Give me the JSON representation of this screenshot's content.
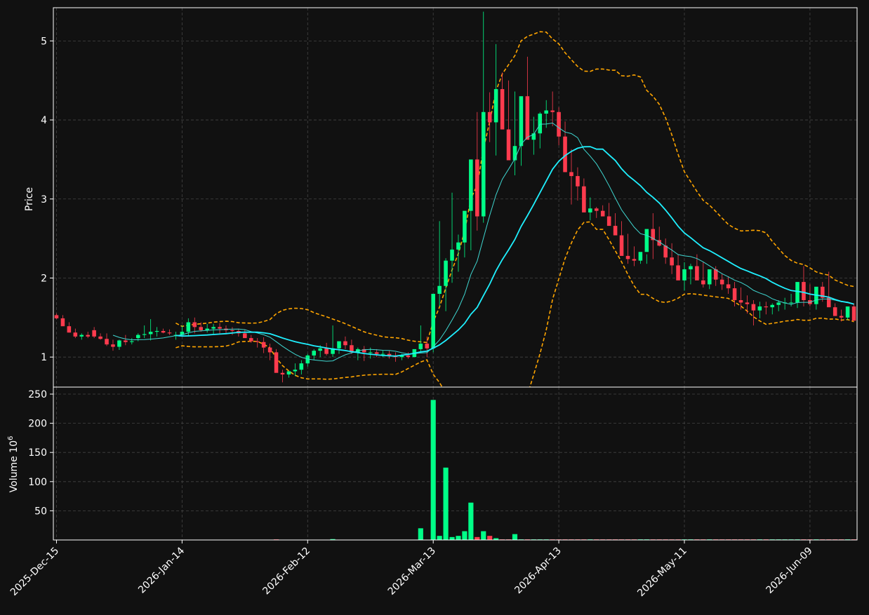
{
  "colors": {
    "background": "#111111",
    "up": "#00ff88",
    "down": "#ff3b4e",
    "grid": "#444444",
    "frame": "#ffffff",
    "ma_fast": "#3fd6d0",
    "ma_slow": "#1ff0ff",
    "band": "#ffa500"
  },
  "chart_data": {
    "type": "candlestick",
    "grid": true,
    "dates": [
      "2025-Dec-15",
      "2025-Dec-16",
      "2025-Dec-17",
      "2025-Dec-18",
      "2025-Dec-19",
      "2025-Dec-22",
      "2025-Dec-23",
      "2025-Dec-24",
      "2025-Dec-26",
      "2025-Dec-29",
      "2025-Dec-30",
      "2025-Dec-31",
      "2026-Jan-02",
      "2026-Jan-05",
      "2026-Jan-06",
      "2026-Jan-07",
      "2026-Jan-08",
      "2026-Jan-09",
      "2026-Jan-12",
      "2026-Jan-13",
      "2026-Jan-14",
      "2026-Jan-15",
      "2026-Jan-16",
      "2026-Jan-20",
      "2026-Jan-21",
      "2026-Jan-22",
      "2026-Jan-23",
      "2026-Jan-26",
      "2026-Jan-27",
      "2026-Jan-28",
      "2026-Jan-29",
      "2026-Jan-30",
      "2026-Feb-02",
      "2026-Feb-03",
      "2026-Feb-04",
      "2026-Feb-05",
      "2026-Feb-06",
      "2026-Feb-09",
      "2026-Feb-10",
      "2026-Feb-11",
      "2026-Feb-12",
      "2026-Feb-13",
      "2026-Feb-17",
      "2026-Feb-18",
      "2026-Feb-19",
      "2026-Feb-20",
      "2026-Feb-23",
      "2026-Feb-24",
      "2026-Feb-25",
      "2026-Feb-26",
      "2026-Feb-27",
      "2026-Mar-02",
      "2026-Mar-03",
      "2026-Mar-04",
      "2026-Mar-05",
      "2026-Mar-06",
      "2026-Mar-09",
      "2026-Mar-10",
      "2026-Mar-11",
      "2026-Mar-12",
      "2026-Mar-13",
      "2026-Mar-16",
      "2026-Mar-17",
      "2026-Mar-18",
      "2026-Mar-19",
      "2026-Mar-20",
      "2026-Mar-23",
      "2026-Mar-24",
      "2026-Mar-25",
      "2026-Mar-26",
      "2026-Mar-27",
      "2026-Mar-30",
      "2026-Mar-31",
      "2026-Apr-01",
      "2026-Apr-02",
      "2026-Apr-06",
      "2026-Apr-07",
      "2026-Apr-08",
      "2026-Apr-09",
      "2026-Apr-10",
      "2026-Apr-13",
      "2026-Apr-14",
      "2026-Apr-15",
      "2026-Apr-16",
      "2026-Apr-17",
      "2026-Apr-20",
      "2026-Apr-21",
      "2026-Apr-22",
      "2026-Apr-23",
      "2026-Apr-24",
      "2026-Apr-27",
      "2026-Apr-28",
      "2026-Apr-29",
      "2026-Apr-30",
      "2026-May-01",
      "2026-May-04",
      "2026-May-05",
      "2026-May-06",
      "2026-May-07",
      "2026-May-08",
      "2026-May-11",
      "2026-May-12",
      "2026-May-13",
      "2026-May-14",
      "2026-May-15",
      "2026-May-18",
      "2026-May-19",
      "2026-May-20",
      "2026-May-21",
      "2026-May-22",
      "2026-May-26",
      "2026-May-27",
      "2026-May-28",
      "2026-May-29",
      "2026-Jun-01",
      "2026-Jun-02",
      "2026-Jun-03",
      "2026-Jun-04",
      "2026-Jun-05",
      "2026-Jun-08",
      "2026-Jun-09",
      "2026-Jun-10",
      "2026-Jun-11",
      "2026-Jun-12",
      "2026-Jun-15"
    ],
    "open": [
      1.53,
      1.49,
      1.39,
      1.31,
      1.26,
      1.28,
      1.34,
      1.26,
      1.23,
      1.16,
      1.13,
      1.21,
      1.19,
      1.24,
      1.28,
      1.29,
      1.32,
      1.33,
      1.31,
      1.27,
      1.28,
      1.32,
      1.44,
      1.38,
      1.34,
      1.36,
      1.38,
      1.36,
      1.34,
      1.33,
      1.3,
      1.24,
      1.2,
      1.19,
      1.12,
      1.06,
      0.8,
      0.78,
      0.82,
      0.84,
      0.92,
      1.02,
      1.08,
      1.11,
      1.04,
      1.11,
      1.2,
      1.15,
      1.06,
      1.1,
      1.06,
      1.06,
      1.04,
      1.04,
      1.02,
      1.0,
      1.02,
      1.0,
      1.1,
      1.17,
      1.11,
      1.8,
      1.9,
      2.22,
      2.36,
      2.45,
      2.85,
      3.5,
      2.78,
      4.1,
      3.97,
      4.39,
      3.88,
      3.49,
      3.67,
      4.3,
      3.75,
      3.83,
      4.08,
      4.12,
      4.1,
      3.79,
      3.34,
      3.29,
      3.16,
      2.83,
      2.88,
      2.85,
      2.78,
      2.66,
      2.54,
      2.28,
      2.24,
      2.22,
      2.33,
      2.62,
      2.48,
      2.41,
      2.26,
      2.16,
      1.97,
      2.11,
      2.15,
      1.97,
      1.92,
      2.11,
      1.98,
      1.92,
      1.87,
      1.72,
      1.69,
      1.67,
      1.59,
      1.64,
      1.63,
      1.66,
      1.69,
      1.69,
      1.69,
      1.95,
      1.72,
      1.67,
      1.89,
      1.75,
      1.63,
      1.52,
      1.5,
      1.64
    ],
    "high": [
      1.55,
      1.53,
      1.44,
      1.36,
      1.3,
      1.32,
      1.38,
      1.3,
      1.3,
      1.22,
      1.22,
      1.28,
      1.24,
      1.3,
      1.4,
      1.48,
      1.38,
      1.36,
      1.35,
      1.32,
      1.4,
      1.49,
      1.5,
      1.44,
      1.42,
      1.42,
      1.43,
      1.4,
      1.38,
      1.36,
      1.35,
      1.28,
      1.24,
      1.25,
      1.17,
      1.1,
      0.84,
      0.82,
      0.92,
      0.96,
      1.04,
      1.1,
      1.15,
      1.18,
      1.4,
      1.18,
      1.26,
      1.22,
      1.12,
      1.14,
      1.12,
      1.1,
      1.08,
      1.08,
      1.06,
      1.04,
      1.06,
      1.04,
      1.4,
      1.26,
      1.25,
      2.72,
      2.25,
      3.08,
      2.55,
      2.52,
      3.0,
      4.1,
      5.37,
      4.35,
      4.96,
      4.6,
      4.5,
      4.36,
      4.04,
      4.8,
      4.04,
      4.1,
      4.25,
      4.36,
      4.16,
      3.98,
      3.63,
      3.4,
      3.26,
      3.02,
      2.9,
      2.92,
      2.95,
      2.82,
      2.72,
      2.56,
      2.4,
      2.3,
      2.3,
      2.82,
      2.65,
      2.5,
      2.44,
      2.3,
      2.2,
      2.18,
      2.3,
      2.2,
      2.02,
      2.15,
      2.05,
      2.02,
      1.95,
      1.88,
      1.78,
      1.72,
      1.7,
      1.7,
      1.68,
      1.72,
      1.75,
      1.8,
      1.8,
      2.15,
      1.92,
      1.78,
      1.95,
      2.08,
      1.68,
      1.6,
      1.58,
      1.68
    ],
    "low": [
      1.48,
      1.42,
      1.31,
      1.24,
      1.22,
      1.24,
      1.24,
      1.22,
      1.14,
      1.08,
      1.09,
      1.15,
      1.16,
      1.2,
      1.24,
      1.21,
      1.26,
      1.3,
      1.28,
      1.22,
      1.26,
      1.26,
      1.3,
      1.32,
      1.31,
      1.29,
      1.3,
      1.29,
      1.28,
      1.26,
      1.26,
      1.18,
      1.12,
      1.05,
      0.96,
      0.98,
      0.68,
      0.74,
      0.76,
      0.78,
      0.88,
      0.96,
      1.0,
      1.02,
      1.0,
      1.04,
      1.1,
      1.04,
      0.96,
      0.95,
      0.98,
      1.0,
      1.0,
      0.98,
      0.94,
      0.96,
      0.98,
      1.0,
      1.05,
      1.0,
      1.06,
      1.64,
      1.58,
      1.94,
      2.08,
      2.26,
      2.35,
      2.6,
      2.7,
      3.72,
      3.55,
      3.92,
      3.62,
      3.3,
      3.42,
      3.78,
      3.56,
      3.64,
      3.9,
      3.92,
      3.68,
      3.34,
      2.93,
      2.98,
      2.86,
      2.73,
      2.76,
      2.78,
      2.71,
      2.57,
      2.33,
      2.18,
      2.15,
      2.18,
      2.18,
      2.24,
      2.4,
      2.18,
      2.05,
      1.98,
      1.84,
      1.92,
      1.98,
      1.88,
      1.86,
      1.9,
      1.85,
      1.8,
      1.64,
      1.6,
      1.55,
      1.4,
      1.49,
      1.54,
      1.54,
      1.58,
      1.6,
      1.64,
      1.62,
      1.64,
      1.64,
      1.6,
      1.7,
      1.66,
      1.52,
      1.45,
      1.47,
      1.48
    ],
    "close": [
      1.49,
      1.39,
      1.31,
      1.26,
      1.28,
      1.26,
      1.26,
      1.23,
      1.16,
      1.13,
      1.21,
      1.19,
      1.2,
      1.28,
      1.29,
      1.32,
      1.33,
      1.31,
      1.3,
      1.28,
      1.32,
      1.44,
      1.38,
      1.34,
      1.36,
      1.38,
      1.36,
      1.34,
      1.33,
      1.3,
      1.24,
      1.2,
      1.19,
      1.12,
      1.06,
      0.8,
      0.78,
      0.82,
      0.84,
      0.92,
      1.02,
      1.08,
      1.11,
      1.04,
      1.11,
      1.2,
      1.15,
      1.06,
      1.1,
      1.06,
      1.06,
      1.04,
      1.04,
      1.02,
      1.0,
      1.02,
      1.0,
      1.1,
      1.17,
      1.11,
      1.8,
      1.9,
      2.22,
      2.36,
      2.45,
      2.85,
      3.5,
      2.78,
      4.1,
      3.97,
      4.39,
      3.88,
      3.49,
      3.67,
      4.3,
      3.75,
      3.83,
      4.08,
      4.12,
      4.1,
      3.79,
      3.34,
      3.29,
      3.16,
      2.83,
      2.88,
      2.85,
      2.78,
      2.66,
      2.54,
      2.28,
      2.24,
      2.22,
      2.33,
      2.62,
      2.48,
      2.41,
      2.26,
      2.16,
      1.97,
      2.11,
      2.15,
      1.97,
      1.92,
      2.11,
      1.98,
      1.92,
      1.87,
      1.72,
      1.69,
      1.67,
      1.59,
      1.64,
      1.63,
      1.66,
      1.69,
      1.69,
      1.69,
      1.95,
      1.72,
      1.67,
      1.89,
      1.75,
      1.63,
      1.52,
      1.5,
      1.64,
      1.46
    ],
    "volume": [
      0.3,
      0.3,
      0.3,
      0.3,
      0.3,
      0.3,
      0.3,
      0.3,
      0.3,
      0.3,
      0.3,
      0.3,
      0.3,
      0.3,
      0.3,
      0.3,
      0.3,
      0.3,
      0.3,
      0.3,
      0.3,
      0.3,
      0.3,
      0.3,
      0.3,
      0.3,
      0.3,
      0.3,
      0.3,
      0.3,
      0.3,
      0.3,
      0.3,
      0.3,
      0.5,
      1.0,
      0.5,
      0.5,
      0.5,
      0.5,
      0.5,
      0.5,
      0.5,
      0.5,
      1.5,
      0.5,
      0.5,
      0.5,
      0.5,
      0.5,
      0.5,
      0.5,
      0.5,
      0.5,
      0.5,
      0.5,
      0.5,
      0.5,
      20,
      0.5,
      240,
      7,
      124,
      5,
      7,
      15,
      64,
      5,
      15,
      7,
      3,
      1,
      1,
      10,
      1,
      1,
      1,
      1,
      1,
      1,
      1,
      1,
      1,
      1,
      1,
      1,
      1,
      1,
      1,
      1,
      1,
      1,
      1,
      1,
      1,
      1,
      1,
      1,
      1,
      1,
      1,
      1,
      1,
      1,
      1,
      1,
      1,
      1,
      1,
      1,
      1,
      1,
      1,
      1,
      1,
      1,
      1,
      1,
      1,
      1,
      1,
      1,
      1,
      1,
      1,
      1,
      1,
      1
    ],
    "price_axis": {
      "label": "Price",
      "ylim": [
        0.62,
        5.42
      ],
      "ticks": [
        1,
        2,
        3,
        4,
        5
      ]
    },
    "volume_axis": {
      "label": "Volume  10",
      "exponent": "6",
      "ylim": [
        0,
        262
      ],
      "ticks": [
        50,
        100,
        150,
        200,
        250
      ]
    },
    "x_ticks": [
      {
        "index": 0,
        "label": "2025-Dec-15"
      },
      {
        "index": 20,
        "label": "2026-Jan-14"
      },
      {
        "index": 40,
        "label": "2026-Feb-12"
      },
      {
        "index": 60,
        "label": "2026-Mar-13"
      },
      {
        "index": 80,
        "label": "2026-Apr-13"
      },
      {
        "index": 100,
        "label": "2026-May-11"
      },
      {
        "index": 120,
        "label": "2026-Jun-09"
      }
    ],
    "overlays": {
      "moving_average_windows": [
        10,
        20
      ],
      "bollinger": {
        "window": 20,
        "stdev": 2
      }
    }
  }
}
